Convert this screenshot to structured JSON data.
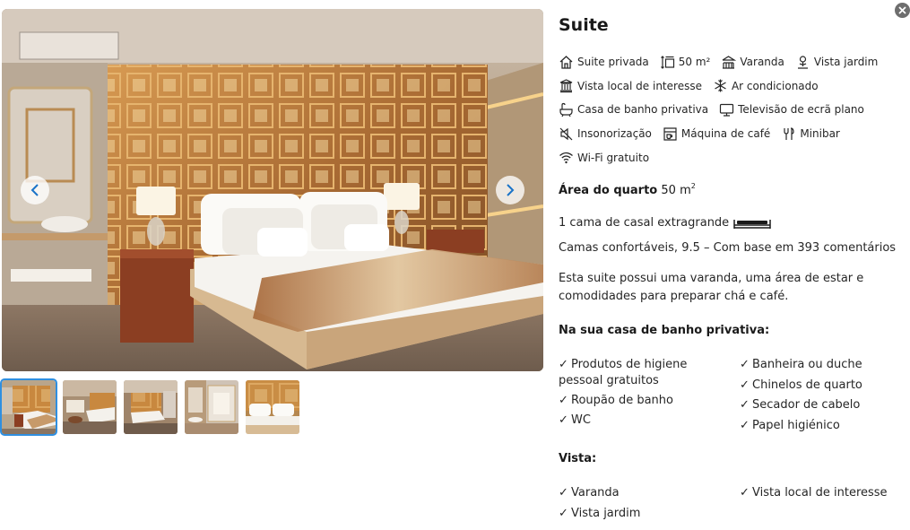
{
  "gallery": {
    "prev_icon": "chevron-left-icon",
    "next_icon": "chevron-right-icon",
    "thumbnail_count": 5,
    "active_thumbnail": 1
  },
  "room": {
    "title": "Suite",
    "facilities": [
      [
        {
          "icon": "house-icon",
          "label": "Suite privada"
        },
        {
          "icon": "size-icon",
          "label": "50 m²"
        },
        {
          "icon": "balcony-icon",
          "label": "Varanda"
        },
        {
          "icon": "garden-icon",
          "label": "Vista jardim"
        }
      ],
      [
        {
          "icon": "landmark-icon",
          "label": "Vista local de interesse"
        },
        {
          "icon": "snowflake-icon",
          "label": "Ar condicionado"
        }
      ],
      [
        {
          "icon": "bathroom-icon",
          "label": "Casa de banho privativa"
        },
        {
          "icon": "tv-icon",
          "label": "Televisão de ecrã plano"
        }
      ],
      [
        {
          "icon": "soundproof-icon",
          "label": "Insonorização"
        },
        {
          "icon": "coffee-machine-icon",
          "label": "Máquina de café"
        },
        {
          "icon": "minibar-icon",
          "label": "Minibar"
        }
      ],
      [
        {
          "icon": "wifi-icon",
          "label": "Wi-Fi gratuito"
        }
      ]
    ],
    "area_label": "Área do quarto",
    "area_value": "50 m",
    "area_sup": "2",
    "bed": "1 cama de casal extragrande",
    "comfort": "Camas confortáveis, 9.5 – Com base em 393 comentários",
    "description": "Esta suite possui uma varanda, uma área de estar e comodidades para preparar chá e café.",
    "bathroom_heading": "Na sua casa de banho privativa:",
    "bathroom_items": [
      "Produtos de higiene pessoal gratuitos",
      "Roupão de banho",
      "WC",
      "Banheira ou duche",
      "Chinelos de quarto",
      "Secador de cabelo",
      "Papel higiénico"
    ],
    "view_heading": "Vista:",
    "view_items": [
      "Varanda",
      "Vista jardim",
      "Vista local de interesse"
    ],
    "check_glyph": "✓"
  }
}
